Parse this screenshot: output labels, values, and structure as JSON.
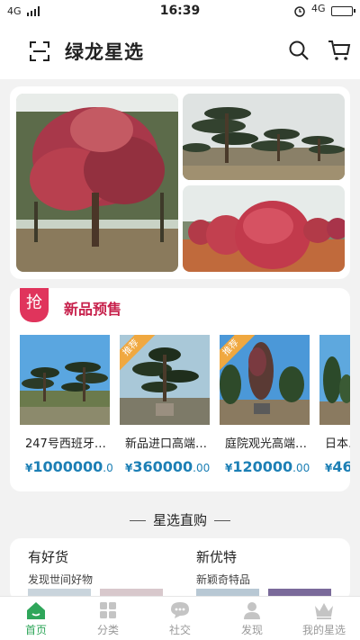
{
  "status_bar": {
    "network_left": "4G",
    "time": "16:39",
    "network_right": "4G"
  },
  "header": {
    "title": "绿龙星选",
    "icons": [
      "scan-icon",
      "search-icon",
      "cart-icon"
    ]
  },
  "banner": {
    "images": [
      "red-maple-tree-photo",
      "pine-bonsai-field-photo",
      "red-shrub-balls-photo"
    ]
  },
  "presale": {
    "badge": "抢",
    "title": "新品预售",
    "products": [
      {
        "name": "247号西班牙…",
        "currency": "¥",
        "price_int": "1000000",
        "price_dec": ".0",
        "recommended": false
      },
      {
        "name": "新品进口高端…",
        "currency": "¥",
        "price_int": "360000",
        "price_dec": ".00",
        "recommended": true,
        "rec_label": "推荐"
      },
      {
        "name": "庭院观光高端…",
        "currency": "¥",
        "price_int": "120000",
        "price_dec": ".00",
        "recommended": true,
        "rec_label": "推荐"
      },
      {
        "name": "日本…",
        "currency": "¥",
        "price_int": "46",
        "price_dec": "",
        "recommended": false
      }
    ]
  },
  "section": {
    "title": "星选直购"
  },
  "goods": {
    "left": {
      "title": "有好货",
      "subtitle": "发现世间好物"
    },
    "right": {
      "title": "新优特",
      "subtitle": "新颖奇特品"
    }
  },
  "tabbar": {
    "items": [
      {
        "label": "首页",
        "icon": "home-icon",
        "active": true
      },
      {
        "label": "分类",
        "icon": "category-icon",
        "active": false
      },
      {
        "label": "社交",
        "icon": "chat-icon",
        "active": false
      },
      {
        "label": "发现",
        "icon": "discover-icon",
        "active": false
      },
      {
        "label": "我的星选",
        "icon": "crown-icon",
        "active": false
      }
    ]
  },
  "colors": {
    "accent_green": "#2fa65a",
    "presale_red": "#e0345c",
    "price_blue": "#1c7fb5",
    "recommend_orange": "#f0a840"
  }
}
